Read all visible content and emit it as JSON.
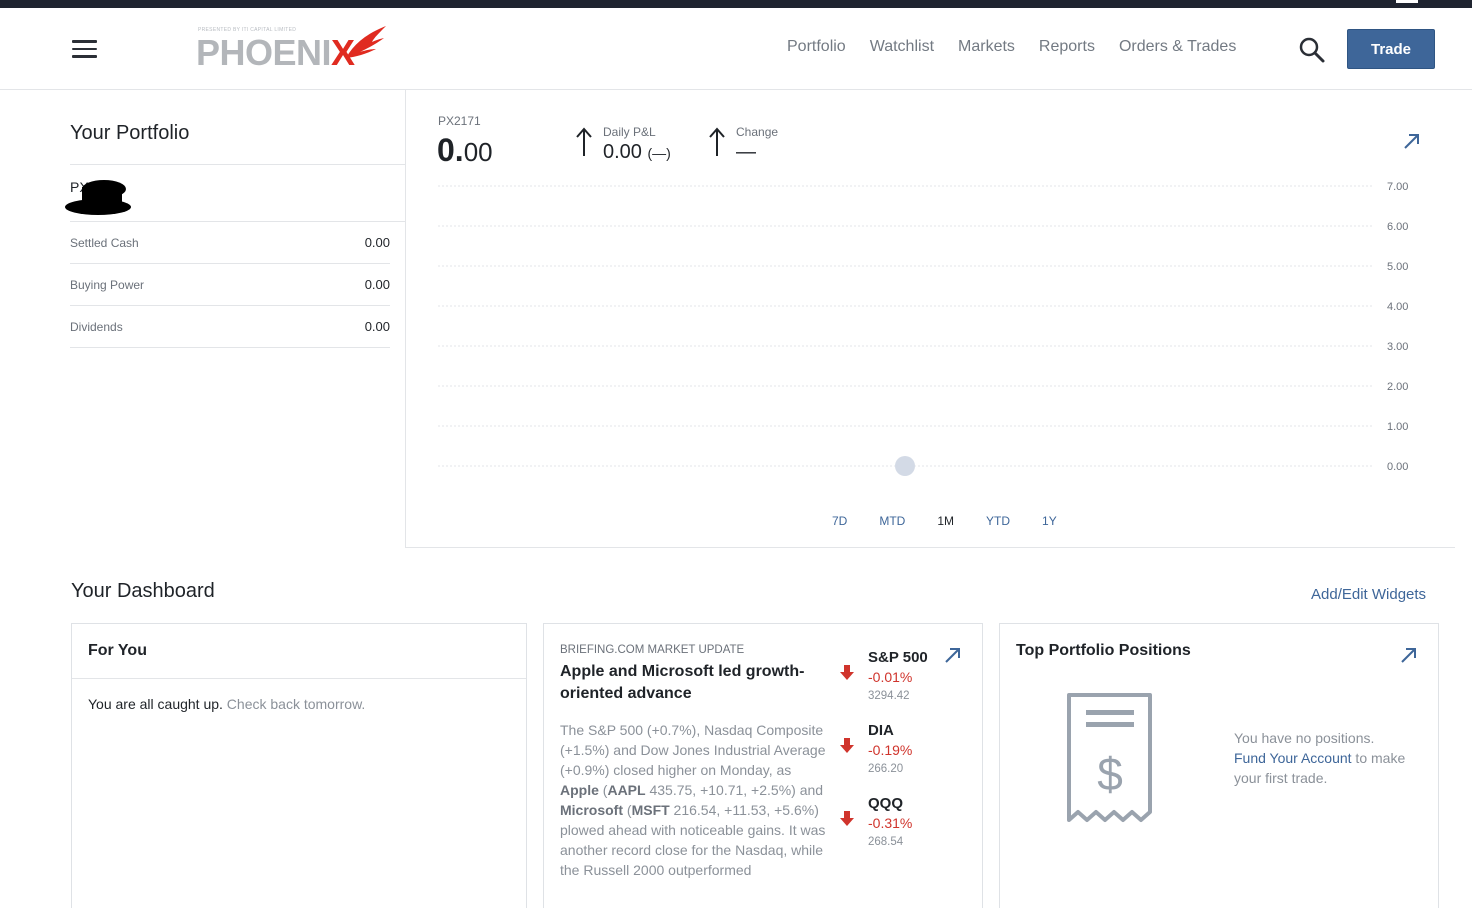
{
  "header": {
    "logo_tagline": "PRESENTED BY ITI CAPITAL LIMITED",
    "logo_name": "PHOENIX",
    "nav": [
      "Portfolio",
      "Watchlist",
      "Markets",
      "Reports",
      "Orders & Trades"
    ],
    "trade_label": "Trade"
  },
  "portfolio": {
    "title": "Your Portfolio",
    "account_label": "PX",
    "stats": [
      {
        "label": "Settled Cash",
        "value": "0.00"
      },
      {
        "label": "Buying Power",
        "value": "0.00"
      },
      {
        "label": "Dividends",
        "value": "0.00"
      }
    ]
  },
  "summary": {
    "account_id": "PX2171",
    "value_int": "0.",
    "value_dec": "00",
    "daily_pl_label": "Daily P&L",
    "daily_pl_value": "0.00",
    "daily_pl_pct": "(—)",
    "change_label": "Change",
    "change_value": "—"
  },
  "chart_data": {
    "type": "line",
    "title": "",
    "xlabel": "",
    "ylabel": "",
    "y_ticks": [
      "7.00",
      "6.00",
      "5.00",
      "4.00",
      "3.00",
      "2.00",
      "1.00",
      "0.00"
    ],
    "ylim": [
      0,
      7
    ],
    "points": [
      {
        "x": 0.5,
        "y": 0
      }
    ],
    "grid": true,
    "range_options": [
      "7D",
      "MTD",
      "1M",
      "YTD",
      "1Y"
    ],
    "active_range": "1M",
    "colors": {
      "point": "#d3dae6",
      "grid": "#e3e5e8"
    }
  },
  "dashboard": {
    "title": "Your Dashboard",
    "add_edit_label": "Add/Edit Widgets",
    "for_you": {
      "title": "For You",
      "message_strong": "You are all caught up.",
      "message_muted": " Check back tomorrow."
    },
    "briefing": {
      "source": "BRIEFING.COM MARKET UPDATE",
      "headline": "Apple and Microsoft led growth-oriented advance",
      "body_1": "The S&P 500 (+0.7%), Nasdaq Composite (+1.5%) and Dow Jones Industrial Average (+0.9%) closed higher on Monday, as ",
      "body_apple": "Apple",
      "body_2": " (",
      "body_aapl": "AAPL",
      "body_3": " 435.75, +10.71, +2.5%) and ",
      "body_msft_name": "Microsoft",
      "body_4": " (",
      "body_msft": "MSFT",
      "body_5": " 216.54, +11.53, +5.6%) plowed ahead with noticeable gains. It was another record close for the Nasdaq, while the Russell 2000 outperformed",
      "indices": [
        {
          "name": "S&P 500",
          "change": "-0.01%",
          "value": "3294.42"
        },
        {
          "name": "DIA",
          "change": "-0.19%",
          "value": "266.20"
        },
        {
          "name": "QQQ",
          "change": "-0.31%",
          "value": "268.54"
        }
      ]
    },
    "positions": {
      "title": "Top Portfolio Positions",
      "msg_1": "You have no positions.",
      "msg_link": "Fund Your Account",
      "msg_2": " to make your first trade."
    }
  },
  "colors": {
    "accent": "#3e6699",
    "negative": "#d0342c"
  }
}
